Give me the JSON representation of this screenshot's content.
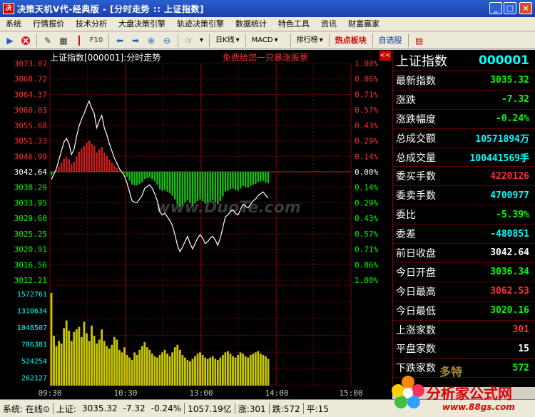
{
  "window": {
    "title": "决策天机V代-经典版 - [分时走势 :: 上证指数]",
    "icon_label": "决"
  },
  "menu": [
    "系统",
    "行情报价",
    "技术分析",
    "大盘决策引擎",
    "轨迹决策引擎",
    "数据统计",
    "特色工具",
    "资讯",
    "财富赢家"
  ],
  "toolbar": {
    "f10": "F10",
    "period": "日K线",
    "indicator": "MACD",
    "ranking": "排行榜",
    "hot": "热点板块",
    "selfselect": "自选股"
  },
  "chart": {
    "title": "上证指数[000001]:分时走势",
    "ad": "免费给您一只暴涨股票",
    "collapse": "<<",
    "watermark": "www.DuoTe.com",
    "price_labels": [
      "3073.07",
      "3068.72",
      "3064.37",
      "3060.03",
      "3055.68",
      "3051.33",
      "3046.99",
      "3042.64",
      "3038.29",
      "3033.95",
      "3029.60",
      "3025.25",
      "3020.91",
      "3016.56",
      "3012.21"
    ],
    "pct_labels": [
      "1.00%",
      "0.86%",
      "0.71%",
      "0.57%",
      "0.43%",
      "0.29%",
      "0.14%",
      "0.00%",
      "0.14%",
      "0.29%",
      "0.43%",
      "0.57%",
      "0.71%",
      "0.86%",
      "1.00%"
    ],
    "vol_labels": [
      "1572761",
      "1310634",
      "1048507",
      "786381",
      "524254",
      "262127"
    ],
    "time_labels": [
      "09:30",
      "10:30",
      "13:00",
      "14:00",
      "15:00"
    ],
    "colors": {
      "up": "#ff3030",
      "down": "#00ff00",
      "flat": "#ffffff",
      "line": "#ffffff",
      "volume": "#c8c800",
      "grid": "#800000"
    }
  },
  "quote": {
    "name": "上证指数",
    "code": "000001",
    "rows": [
      {
        "label": "最新指数",
        "value": "3035.32",
        "color": "#00ff00"
      },
      {
        "label": "涨跌",
        "value": "-7.32",
        "color": "#00ff00"
      },
      {
        "label": "涨跌幅度",
        "value": "-0.24%",
        "color": "#00ff00"
      },
      {
        "label": "总成交额",
        "value": "10571894万",
        "color": "#00ffff"
      },
      {
        "label": "总成交量",
        "value": "100441569手",
        "color": "#00ffff"
      },
      {
        "label": "委买手数",
        "value": "4220126",
        "color": "#ff3030"
      },
      {
        "label": "委卖手数",
        "value": "4700977",
        "color": "#00ffff"
      },
      {
        "label": "委比",
        "value": "-5.39%",
        "color": "#00ff00"
      },
      {
        "label": "委差",
        "value": "-480851",
        "color": "#00ffff"
      },
      {
        "label": "前日收盘",
        "value": "3042.64",
        "color": "#ffffff"
      },
      {
        "label": "今日开盘",
        "value": "3036.34",
        "color": "#00ff00"
      },
      {
        "label": "今日最高",
        "value": "3062.53",
        "color": "#ff3030"
      },
      {
        "label": "今日最低",
        "value": "3020.16",
        "color": "#00ff00"
      },
      {
        "label": "上涨家数",
        "value": "301",
        "color": "#ff3030"
      },
      {
        "label": "平盘家数",
        "value": "15",
        "color": "#ffffff"
      },
      {
        "label": "下跌家数",
        "value": "572",
        "color": "#00ff00"
      }
    ]
  },
  "status": {
    "system": "系统: 在线⊙",
    "index_label": "上证:",
    "price": "3035.32",
    "change": "-7.32",
    "pct": "-0.24%",
    "amount": "1057.19亿",
    "up": "涨:301",
    "down": "跌:572",
    "flat": "平:15"
  },
  "branding": {
    "site": "分析家公式网",
    "url": "www.88gs.com",
    "mark": "多特"
  },
  "chart_data": {
    "type": "line",
    "title": "上证指数[000001]:分时走势",
    "prev_close": 3042.64,
    "ylim": [
      3012.21,
      3073.07
    ],
    "volume_ylim": [
      0,
      1572761
    ],
    "x_ticks": [
      "09:30",
      "10:30",
      "13:00",
      "14:00",
      "15:00"
    ],
    "series": [
      {
        "name": "price",
        "values": [
          3040.5,
          3042.0,
          3043.5,
          3046.0,
          3048.5,
          3051.0,
          3052.0,
          3050.5,
          3047.5,
          3049.0,
          3052.5,
          3055.5,
          3057.5,
          3059.0,
          3061.0,
          3062.5,
          3060.5,
          3059.0,
          3055.0,
          3057.0,
          3058.5,
          3055.0,
          3053.0,
          3050.5,
          3048.5,
          3046.5,
          3045.0,
          3043.5,
          3042.5,
          3041.5,
          3039.5,
          3037.0,
          3034.5,
          3034.0,
          3034.0,
          3035.0,
          3036.0,
          3038.0,
          3038.5,
          3039.0,
          3038.0,
          3036.5,
          3034.5,
          3031.5,
          3030.5,
          3031.0,
          3030.0,
          3029.0,
          3027.5,
          3025.0,
          3022.0,
          3020.2,
          3021.5,
          3023.0,
          3024.5,
          3022.5,
          3021.0,
          3022.5,
          3024.0,
          3025.0,
          3024.0,
          3022.5,
          3023.0,
          3024.0,
          3024.5,
          3023.5,
          3022.0,
          3024.0,
          3027.0,
          3030.0,
          3030.5,
          3031.5,
          3032.0,
          3031.0,
          3030.5,
          3032.0,
          3033.5,
          3033.0,
          3032.5,
          3033.5,
          3034.5,
          3035.0,
          3036.0,
          3036.5,
          3037.0,
          3036.0,
          3035.3
        ]
      },
      {
        "name": "volume",
        "values": [
          1450000,
          780000,
          620000,
          700000,
          660000,
          900000,
          1020000,
          860000,
          700000,
          840000,
          880000,
          920000,
          760000,
          1000000,
          820000,
          700000,
          940000,
          780000,
          660000,
          720000,
          880000,
          700000,
          620000,
          580000,
          640000,
          760000,
          720000,
          560000,
          520000,
          600000,
          480000,
          440000,
          400000,
          520000,
          480000,
          560000,
          620000,
          680000,
          600000,
          560000,
          500000,
          460000,
          440000,
          480000,
          520000,
          560000,
          500000,
          460000,
          520000,
          600000,
          640000,
          560000,
          480000,
          440000,
          400000,
          380000,
          420000,
          460000,
          500000,
          520000,
          480000,
          440000,
          420000,
          440000,
          460000,
          420000,
          400000,
          440000,
          480000,
          520000,
          540000,
          500000,
          460000,
          440000,
          480000,
          520000,
          500000,
          460000,
          440000,
          480000,
          500000,
          520000,
          540000,
          500000,
          480000,
          460000,
          420000
        ]
      }
    ]
  }
}
